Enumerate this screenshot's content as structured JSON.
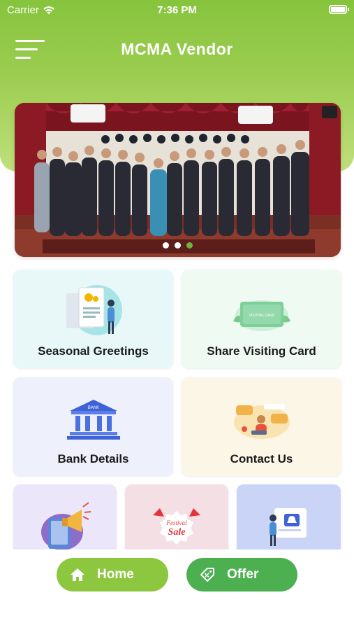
{
  "status_bar": {
    "carrier": "Carrier",
    "time": "7:36 PM"
  },
  "header": {
    "title": "MCMA Vendor",
    "menu_icon": "hamburger-menu-icon"
  },
  "banner": {
    "slide_count": 3,
    "active_slide": 3
  },
  "tiles": {
    "seasonal_greetings": "Seasonal Greetings",
    "share_visiting_card": "Share Visiting Card",
    "bank_details": "Bank Details",
    "contact_us": "Contact Us",
    "festival_sale_text": "Festival",
    "festival_sale_word": "Sale"
  },
  "visiting_card_text": "VISITING CARD",
  "bank_text": "BANK",
  "bottom_nav": {
    "home": "Home",
    "offer": "Offer"
  },
  "colors": {
    "header_green": "#8dc63f",
    "home_pill": "#8dc63f",
    "offer_pill": "#4caf50",
    "active_dot": "#6db33f"
  }
}
